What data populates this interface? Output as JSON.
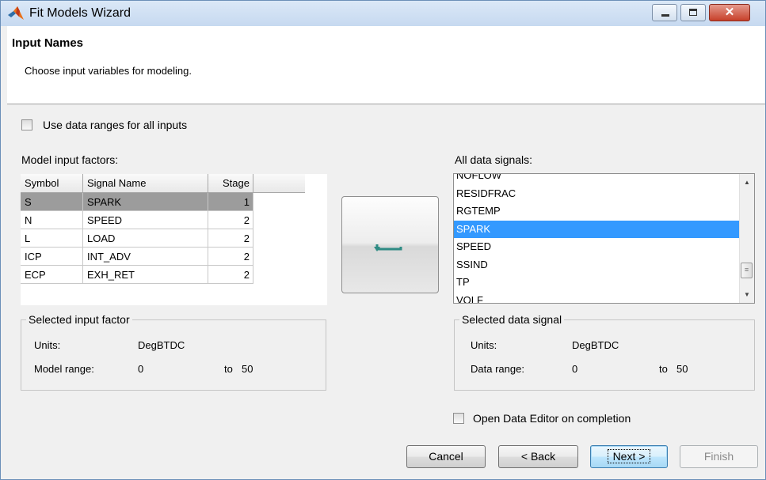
{
  "window": {
    "title": "Fit Models Wizard",
    "controls": {
      "minimize": "minimize",
      "maximize": "maximize",
      "close": "✕"
    }
  },
  "header": {
    "title": "Input Names",
    "description": "Choose input variables for modeling."
  },
  "use_data_ranges": {
    "label": "Use data ranges for all inputs",
    "checked": false
  },
  "model_inputs": {
    "label": "Model input factors:",
    "columns": [
      "Symbol",
      "Signal Name",
      "Stage"
    ],
    "rows": [
      {
        "symbol": "S",
        "signal": "SPARK",
        "stage": "1",
        "selected": true
      },
      {
        "symbol": "N",
        "signal": "SPEED",
        "stage": "2",
        "selected": false
      },
      {
        "symbol": "L",
        "signal": "LOAD",
        "stage": "2",
        "selected": false
      },
      {
        "symbol": "ICP",
        "signal": "INT_ADV",
        "stage": "2",
        "selected": false
      },
      {
        "symbol": "ECP",
        "signal": "EXH_RET",
        "stage": "2",
        "selected": false
      }
    ]
  },
  "swap_button": {
    "icon": "swap-arrow-icon"
  },
  "data_signals": {
    "label": "All data signals:",
    "items": [
      "NOFLOW",
      "RESIDFRAC",
      "RGTEMP",
      "SPARK",
      "SPEED",
      "SSIND",
      "TP",
      "VOLF"
    ],
    "selected": "SPARK"
  },
  "selected_input": {
    "title": "Selected input factor",
    "units_label": "Units:",
    "units": "DegBTDC",
    "range_label": "Model range:",
    "min": "0",
    "to": "to",
    "max": "50"
  },
  "selected_signal": {
    "title": "Selected data signal",
    "units_label": "Units:",
    "units": "DegBTDC",
    "range_label": "Data range:",
    "min": "0",
    "to": "to",
    "max": "50"
  },
  "open_editor": {
    "label": "Open Data Editor on completion",
    "checked": false
  },
  "buttons": {
    "cancel": "Cancel",
    "back": "< Back",
    "next": "Next >",
    "finish": "Finish"
  },
  "colors": {
    "selection": "#3399ff",
    "table_selection": "#9c9c9c",
    "arrow": "#2e8b84"
  }
}
